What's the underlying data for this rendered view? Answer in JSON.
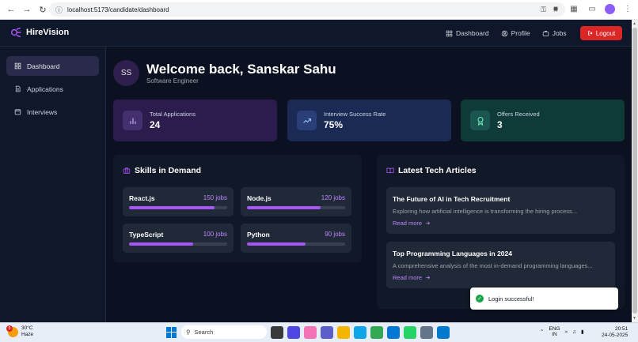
{
  "browser": {
    "url": "localhost:5173/candidate/dashboard"
  },
  "header": {
    "brand": "HireVision",
    "nav": [
      {
        "label": "Dashboard",
        "icon": "grid-icon"
      },
      {
        "label": "Profile",
        "icon": "user-circle-icon"
      },
      {
        "label": "Jobs",
        "icon": "briefcase-icon"
      }
    ],
    "logout_label": "Logout"
  },
  "sidebar": {
    "items": [
      {
        "label": "Dashboard",
        "icon": "grid-icon",
        "active": true
      },
      {
        "label": "Applications",
        "icon": "document-icon",
        "active": false
      },
      {
        "label": "Interviews",
        "icon": "calendar-icon",
        "active": false
      }
    ]
  },
  "welcome": {
    "initials": "SS",
    "title": "Welcome back, Sanskar Sahu",
    "role": "Software Engineer"
  },
  "stats": [
    {
      "label": "Total Applications",
      "value": "24",
      "icon": "bar-chart-icon",
      "color": "#2b1c4d"
    },
    {
      "label": "Interview Success Rate",
      "value": "75%",
      "icon": "trending-up-icon",
      "color": "#1b2a55"
    },
    {
      "label": "Offers Received",
      "value": "3",
      "icon": "award-icon",
      "color": "#0e3a38"
    }
  ],
  "skills": {
    "title": "Skills in Demand",
    "items": [
      {
        "name": "React.js",
        "jobs": "150 jobs",
        "level": 0.87
      },
      {
        "name": "Node.js",
        "jobs": "120 jobs",
        "level": 0.75
      },
      {
        "name": "TypeScript",
        "jobs": "100 jobs",
        "level": 0.65
      },
      {
        "name": "Python",
        "jobs": "90 jobs",
        "level": 0.6
      }
    ]
  },
  "articles": {
    "title": "Latest Tech Articles",
    "items": [
      {
        "title": "The Future of AI in Tech Recruitment",
        "desc": "Exploring how artificial intelligence is transforming the hiring process...",
        "link": "Read more"
      },
      {
        "title": "Top Programming Languages in 2024",
        "desc": "A comprehensive analysis of the most in-demand programming languages...",
        "link": "Read more"
      }
    ]
  },
  "toast": {
    "message": "Login successful!"
  },
  "taskbar": {
    "temperature": "30°C",
    "weather": "Haze",
    "weather_badge": "5",
    "search_placeholder": "Search",
    "lang_line1": "ENG",
    "lang_line2": "IN",
    "time": "20:51",
    "date": "24-05-2025"
  },
  "colors": {
    "accent": "#a855f7",
    "logout": "#dc2626",
    "background": "#0b1120"
  }
}
